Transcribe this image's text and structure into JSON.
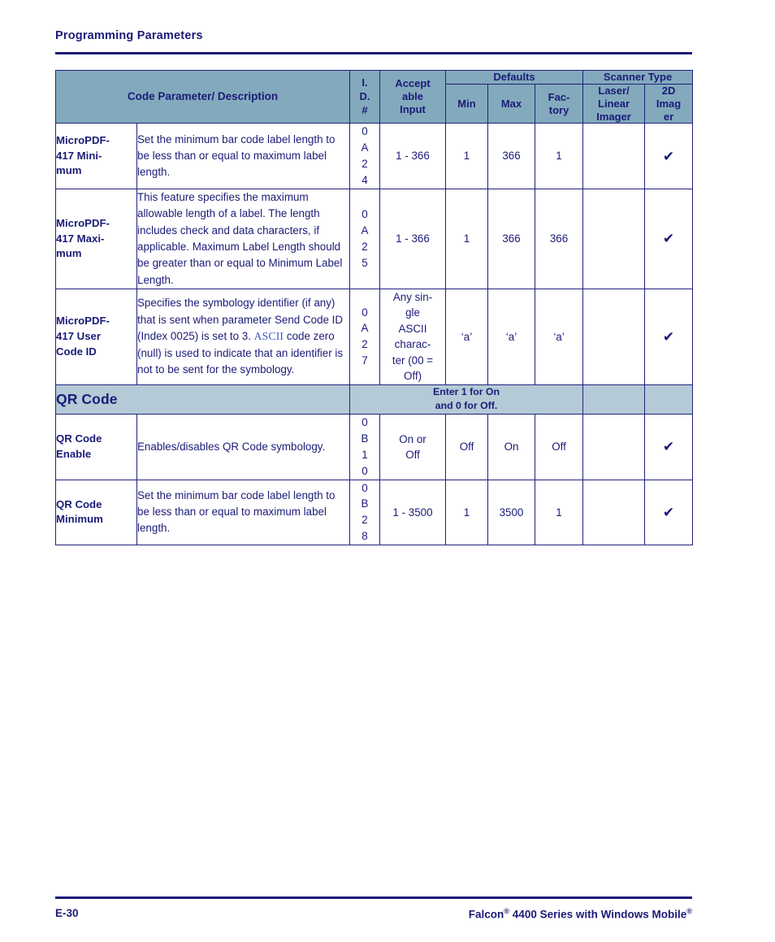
{
  "running_head": "Programming Parameters",
  "table": {
    "headers": {
      "param_desc": "Code Parameter/ Description",
      "id": "I.\nD.\n#",
      "id_lines": [
        "I.",
        "D.",
        "#"
      ],
      "acceptable_input": "Accept\nable\nInput",
      "acceptable_lines": [
        "Accept",
        "able",
        "Input"
      ],
      "defaults_group": "Defaults",
      "scanner_type_group": "Scanner Type",
      "min": "Min",
      "max": "Max",
      "factory_lines": [
        "Fac-",
        "tory"
      ],
      "laser_lines": [
        "Laser/",
        "Linear",
        "Imager"
      ],
      "imager2d_lines": [
        "2D",
        "Imag",
        "er"
      ]
    },
    "rows": [
      {
        "kind": "data",
        "param_lines": [
          "MicroPDF-",
          "417 Mini-",
          "mum"
        ],
        "description": "Set the minimum bar code label length to be less than or equal to maximum label length.",
        "id_digits": [
          "0",
          "A",
          "2",
          "4"
        ],
        "acceptable": "1 - 366",
        "min": "1",
        "max": "366",
        "factory": "1",
        "laser_linear_imager": "",
        "imager_2d": "✔"
      },
      {
        "kind": "data",
        "param_lines": [
          "MicroPDF-",
          "417 Maxi-",
          "mum"
        ],
        "description": "This feature specifies the maximum allowable length of a label. The length includes check and data characters, if applicable. Maximum Label Length should be greater than or equal to Minimum Label Length.",
        "id_digits": [
          "0",
          "A",
          "2",
          "5"
        ],
        "acceptable": "1 - 366",
        "min": "1",
        "max": "366",
        "factory": "366",
        "laser_linear_imager": "",
        "imager_2d": "✔"
      },
      {
        "kind": "data-ascii",
        "param_lines": [
          "MicroPDF-",
          "417 User",
          "Code ID"
        ],
        "desc_part1": "Specifies the symbology identifier (if any) that is sent when parameter Send Code ID (Index 0025) is set to 3. ",
        "desc_link": "ASCII",
        "desc_part2": " code zero (null) is used to indicate that an identifier is not to be sent for the symbology.",
        "id_digits": [
          "0",
          "A",
          "2",
          "7"
        ],
        "acceptable_lines": [
          "Any sin-",
          "gle",
          "ASCII",
          "charac-",
          "ter (00 =",
          "Off)"
        ],
        "min": "‘a’",
        "max": "‘a’",
        "factory": "‘a’",
        "laser_linear_imager": "",
        "imager_2d": "✔"
      },
      {
        "kind": "band",
        "title": "QR Code",
        "note_lines": [
          "Enter 1 for On",
          "and 0 for Off."
        ]
      },
      {
        "kind": "data",
        "param_lines": [
          "QR Code",
          "Enable"
        ],
        "description": "Enables/disables QR Code symbology.",
        "id_digits": [
          "0",
          "B",
          "1",
          "0"
        ],
        "acceptable_lines": [
          "On or",
          "Off"
        ],
        "acceptable": "On or Off",
        "min": "Off",
        "max": "On",
        "factory": "Off",
        "laser_linear_imager": "",
        "imager_2d": "✔"
      },
      {
        "kind": "data",
        "param_lines": [
          "QR Code",
          "Minimum"
        ],
        "description": "Set the minimum bar code label length to be less than or equal to maximum label length.",
        "id_digits": [
          "0",
          "B",
          "2",
          "8"
        ],
        "acceptable": "1 - 3500",
        "min": "1",
        "max": "3500",
        "factory": "1",
        "laser_linear_imager": "",
        "imager_2d": "✔"
      }
    ]
  },
  "footer": {
    "page_number": "E-30",
    "doc_title_part1": "Falcon",
    "doc_title_reg1": "®",
    "doc_title_part2": " 4400 Series with Windows Mobile",
    "doc_title_reg2": "®"
  },
  "colors": {
    "ink": "#1b1b78",
    "header_band": "#82aabc",
    "section_band": "#b4cad6",
    "link": "#3e55c8",
    "border": "#21217e"
  }
}
